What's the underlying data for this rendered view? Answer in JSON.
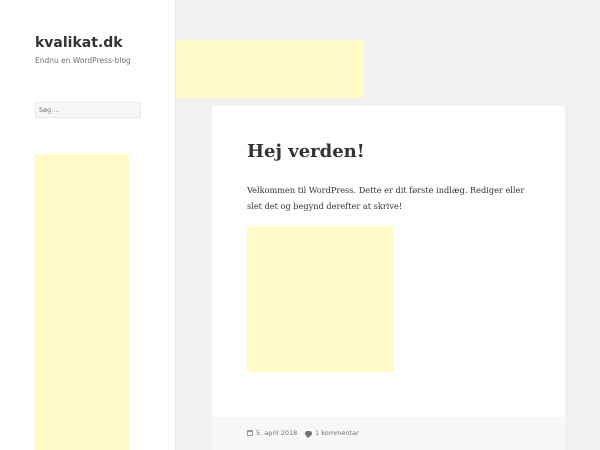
{
  "site": {
    "title": "kvalikat.dk",
    "description": "Endnu en WordPress-blog"
  },
  "search": {
    "placeholder": "Søg ..."
  },
  "post": {
    "title": "Hej verden!",
    "content": "Velkommen til WordPress. Dette er dit første indlæg. Rediger eller slet det og begynd derefter at skrive!",
    "date": "5. april 2018",
    "comments": "1 kommentar"
  },
  "icons": {
    "date": "calendar-icon",
    "comments": "comment-bubble-icon"
  },
  "colors": {
    "ad_placeholder": "#fffac6",
    "page_background": "#f1f1f1",
    "text": "#333333",
    "meta_text": "#707070"
  }
}
